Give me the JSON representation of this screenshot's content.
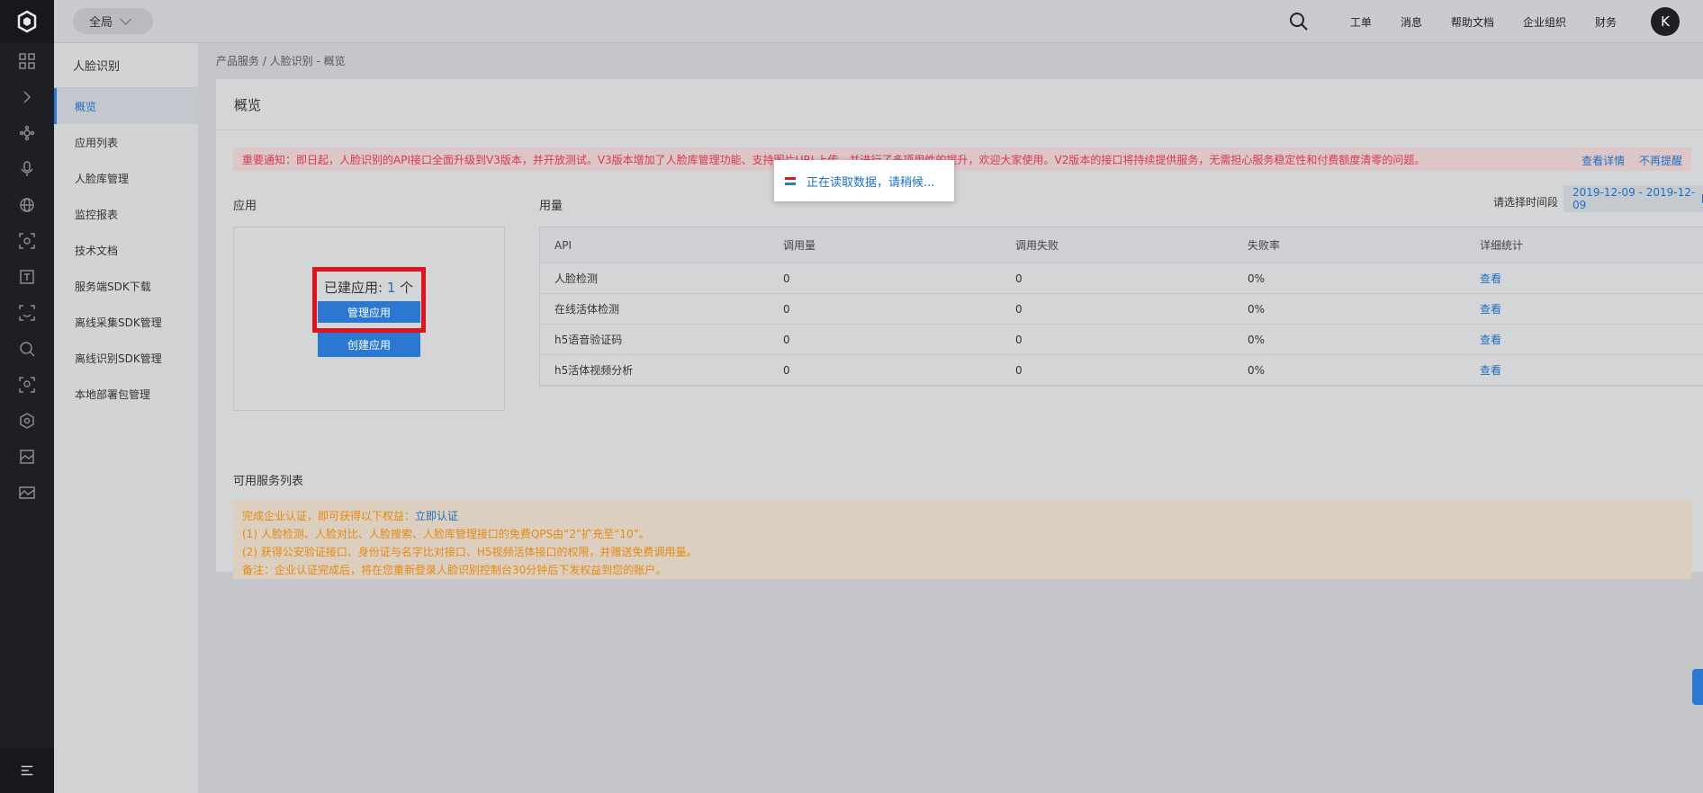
{
  "topbar": {
    "scope": "全局",
    "nav": [
      "工单",
      "消息",
      "帮助文档",
      "企业组织",
      "财务"
    ],
    "avatar": "K"
  },
  "sidebar": {
    "title": "人脸识别",
    "items": [
      {
        "label": "概览",
        "active": true
      },
      {
        "label": "应用列表"
      },
      {
        "label": "人脸库管理"
      },
      {
        "label": "监控报表"
      },
      {
        "label": "技术文档"
      },
      {
        "label": "服务端SDK下载"
      },
      {
        "label": "离线采集SDK管理"
      },
      {
        "label": "离线识别SDK管理"
      },
      {
        "label": "本地部署包管理"
      }
    ]
  },
  "breadcrumb": "产品服务 / 人脸识别 - 概览",
  "page_title": "概览",
  "notice": {
    "text": "重要通知：即日起，人脸识别的API接口全面升级到V3版本，并开放测试。V3版本增加了人脸库管理功能、支持图片URL上传，并进行了多项用性的提升，欢迎大家使用。V2版本的接口将持续提供服务，无需担心服务稳定性和付费额度清零的问题。",
    "link_detail": "查看详情",
    "link_dismiss": "不再提醒"
  },
  "app": {
    "label": "应用",
    "count_label": "已建应用: ",
    "count": "1",
    "count_unit": " 个",
    "manage_button": "管理应用",
    "create_button": "创建应用"
  },
  "usage": {
    "label": "用量",
    "date_label": "请选择时间段",
    "date_range": "2019-12-09 - 2019-12-09",
    "headers": [
      "API",
      "调用量",
      "调用失败",
      "失败率",
      "详细统计"
    ],
    "rows": [
      {
        "api": "人脸检测",
        "calls": "0",
        "fails": "0",
        "rate": "0%",
        "detail": "查看"
      },
      {
        "api": "在线活体检测",
        "calls": "0",
        "fails": "0",
        "rate": "0%",
        "detail": "查看"
      },
      {
        "api": "h5语音验证码",
        "calls": "0",
        "fails": "0",
        "rate": "0%",
        "detail": "查看"
      },
      {
        "api": "h5活体视频分析",
        "calls": "0",
        "fails": "0",
        "rate": "0%",
        "detail": "查看"
      }
    ]
  },
  "services": {
    "label": "可用服务列表",
    "line1_prefix": "完成企业认证，即可获得以下权益：",
    "line1_link": "立即认证",
    "line2": "(1) 人脸检测、人脸对比、人脸搜索、人脸库管理接口的免费QPS由“2”扩充至“10”。",
    "line3": "(2) 获得公安验证接口、身份证与名字比对接口、H5视频活体接口的权限，并赠送免费调用量。",
    "line4": "备注：企业认证完成后，将在您重新登录人脸识别控制台30分钟后下发权益到您的账户。"
  },
  "toast": {
    "text": "正在读取数据，请稍候...",
    "colors": [
      "#e0141e",
      "#ffffff",
      "#2a78d2"
    ]
  }
}
